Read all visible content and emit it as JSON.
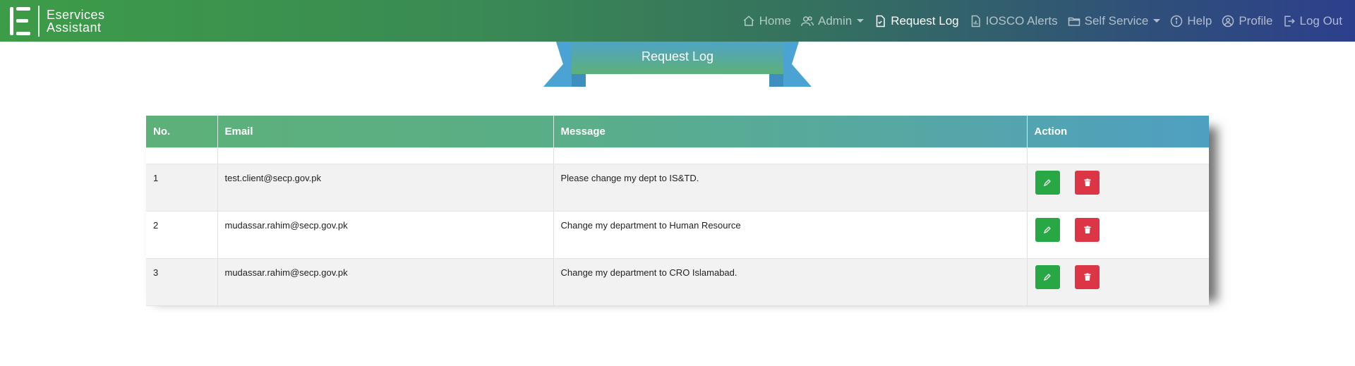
{
  "brand": {
    "line1": "Eservices",
    "line2": "Assistant",
    "logo_icon": "letter-e-logo"
  },
  "nav": {
    "items": [
      {
        "label": "Home",
        "icon": "home-icon",
        "dropdown": false,
        "active": false
      },
      {
        "label": "Admin",
        "icon": "users-icon",
        "dropdown": true,
        "active": false
      },
      {
        "label": "Request Log",
        "icon": "file-check-icon",
        "dropdown": false,
        "active": true
      },
      {
        "label": "IOSCO Alerts",
        "icon": "report-icon",
        "dropdown": false,
        "active": false
      },
      {
        "label": "Self Service",
        "icon": "folder-icon",
        "dropdown": true,
        "active": false
      },
      {
        "label": "Help",
        "icon": "info-icon",
        "dropdown": false,
        "active": false
      },
      {
        "label": "Profile",
        "icon": "user-circle-icon",
        "dropdown": false,
        "active": false
      },
      {
        "label": "Log Out",
        "icon": "logout-icon",
        "dropdown": false,
        "active": false
      }
    ]
  },
  "ribbon": {
    "title": "Request Log"
  },
  "table": {
    "headers": {
      "no": "No.",
      "email": "Email",
      "message": "Message",
      "action": "Action"
    },
    "rows": [
      {
        "no": "1",
        "email": "test.client@secp.gov.pk",
        "message": "Please change my dept to IS&TD."
      },
      {
        "no": "2",
        "email": "mudassar.rahim@secp.gov.pk",
        "message": "Change my department to Human Resource"
      },
      {
        "no": "3",
        "email": "mudassar.rahim@secp.gov.pk",
        "message": "Change my department to CRO Islamabad."
      }
    ]
  },
  "colors": {
    "nav_start": "#3d9c47",
    "nav_end": "#2d3f8c",
    "edit_button": "#28a745",
    "delete_button": "#dc3545",
    "ribbon_blue": "#4ba3d4",
    "ribbon_green": "#5db078"
  }
}
